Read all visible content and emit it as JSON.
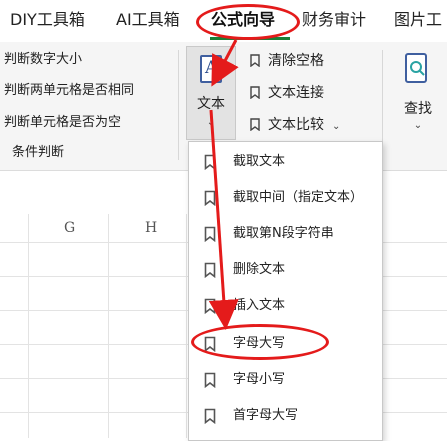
{
  "tabs": [
    {
      "label": "DIY工具箱"
    },
    {
      "label": "AI工具箱"
    },
    {
      "label": "公式向导"
    },
    {
      "label": "财务审计"
    },
    {
      "label": "图片工"
    }
  ],
  "ribbon": {
    "left_items": [
      "判断数字大小",
      "判断两单元格是否相同",
      "判断单元格是否为空",
      "条件判断"
    ],
    "text_button": {
      "icon_glyph": "A",
      "label": "文本"
    },
    "right_items": [
      "清除空格",
      "文本连接",
      "文本比较"
    ],
    "find_button": {
      "label": "查找"
    }
  },
  "sheet": {
    "columns": [
      "G",
      "H"
    ]
  },
  "dropdown": {
    "items": [
      "截取文本",
      "截取中间（指定文本）",
      "截取第N段字符串",
      "删除文本",
      "插入文本",
      "字母大写",
      "字母小写",
      "首字母大写"
    ]
  },
  "colors": {
    "annotation": "#e41b1b",
    "active_tab": "#1a7f37",
    "icon_blue": "#3f5f9f"
  }
}
